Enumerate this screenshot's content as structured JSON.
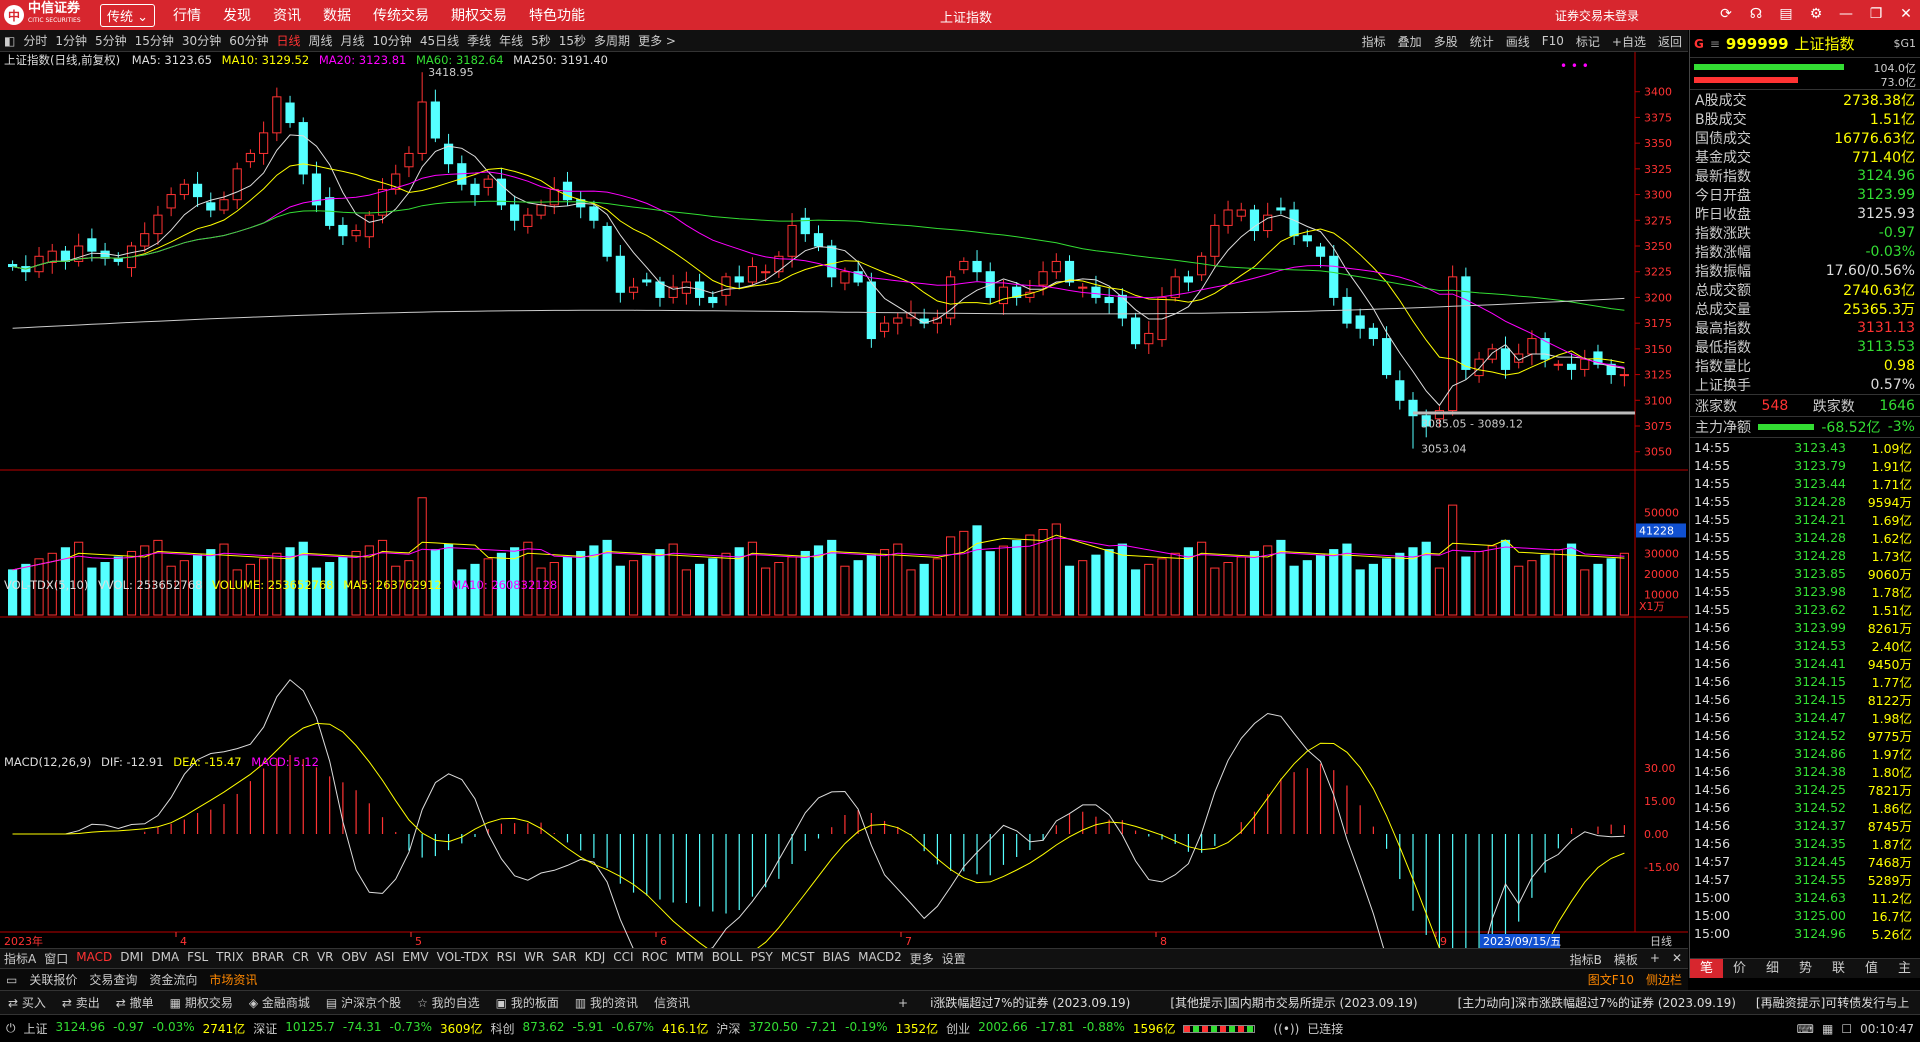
{
  "topbar": {
    "logo": "中信证券",
    "logo_en": "CITIC SECURITIES",
    "mode": "传统 ⌄",
    "menus": [
      "行情",
      "发现",
      "资讯",
      "数据",
      "传统交易",
      "期权交易",
      "特色功能"
    ],
    "title": "上证指数",
    "login": "证券交易未登录"
  },
  "periods": [
    "分时",
    "1分钟",
    "5分钟",
    "15分钟",
    "30分钟",
    "60分钟",
    "日线",
    "周线",
    "月线",
    "10分钟",
    "45日线",
    "季线",
    "年线",
    "5秒",
    "15秒",
    "多周期",
    "更多 >"
  ],
  "active_period": "日线",
  "tools": [
    "指标",
    "叠加",
    "多股",
    "统计",
    "画线",
    "F10",
    "标记",
    "+自选",
    "返回"
  ],
  "main_legend": {
    "name": "上证指数(日线,前复权)",
    "ma5": "MA5: 3123.65",
    "ma10": "MA10: 3129.52",
    "ma20": "MA20: 3123.81",
    "ma60": "MA60: 3182.64",
    "ma250": "MA250: 3191.40"
  },
  "vol_legend": {
    "name": "VOL-TDX(5,10)",
    "vvol": "VVOL: 253652768",
    "volume": "VOLUME: 253652768",
    "ma5": "MA5: 263762912",
    "ma10": "MA10: 260832128"
  },
  "macd_legend": {
    "name": "MACD(12,26,9)",
    "dif": "DIF: -12.91",
    "dea": "DEA: -15.47",
    "macd": "MACD: 5.12"
  },
  "annotations": {
    "high": "3418.95",
    "low": "3053.04",
    "range": "3085.05 - 3089.12",
    "vol_marker": "41228",
    "vol_unit": "X1万",
    "date_marker": "2023/09/15/五",
    "daily": "日线"
  },
  "price_axis": [
    "3400",
    "3375",
    "3350",
    "3325",
    "3300",
    "3275",
    "3250",
    "3225",
    "3200",
    "3175",
    "3150",
    "3125",
    "3100",
    "3075",
    "3050"
  ],
  "vol_axis": [
    "50000",
    "40000",
    "30000",
    "20000",
    "10000"
  ],
  "macd_axis": [
    "30.00",
    "15.00",
    "0.00",
    "-15.00"
  ],
  "x_axis": [
    "2023年",
    "4",
    "5",
    "6",
    "7",
    "8",
    "9"
  ],
  "chart_data": {
    "type": "candlestick",
    "title": "上证指数(日线,前复权)",
    "ylim": [
      3040,
      3425
    ],
    "latest": {
      "open": 3123.99,
      "close": 3124.96,
      "high": 3131.13,
      "low": 3113.53
    },
    "close": [
      3230,
      3225,
      3240,
      3245,
      3235,
      3250,
      3245,
      3238,
      3235,
      3250,
      3262,
      3280,
      3300,
      3310,
      3298,
      3285,
      3295,
      3325,
      3340,
      3360,
      3395,
      3370,
      3320,
      3290,
      3270,
      3260,
      3265,
      3280,
      3305,
      3320,
      3340,
      3390,
      3355,
      3330,
      3310,
      3300,
      3315,
      3290,
      3275,
      3280,
      3290,
      3305,
      3295,
      3288,
      3275,
      3240,
      3205,
      3210,
      3215,
      3200,
      3210,
      3215,
      3200,
      3195,
      3220,
      3215,
      3230,
      3225,
      3240,
      3270,
      3262,
      3250,
      3220,
      3225,
      3215,
      3160,
      3175,
      3180,
      3185,
      3175,
      3180,
      3220,
      3235,
      3225,
      3200,
      3210,
      3200,
      3205,
      3225,
      3235,
      3215,
      3210,
      3200,
      3195,
      3180,
      3155,
      3165,
      3200,
      3220,
      3215,
      3240,
      3270,
      3285,
      3285,
      3265,
      3280,
      3285,
      3260,
      3255,
      3240,
      3200,
      3175,
      3170,
      3160,
      3125,
      3100,
      3085,
      3075,
      3090,
      3220,
      3130,
      3140,
      3150,
      3130,
      3145,
      3160,
      3140,
      3135,
      3130,
      3140,
      3135,
      3125,
      3124.96
    ]
  },
  "right": {
    "code": "999999",
    "name": "上证指数",
    "sg": "$G1",
    "bar1": "104.0亿",
    "bar2": "73.0亿",
    "stats": [
      [
        "A股成交",
        "2738.38亿",
        "ye"
      ],
      [
        "B股成交",
        "1.51亿",
        "ye"
      ],
      [
        "国债成交",
        "16776.63亿",
        "ye"
      ],
      [
        "基金成交",
        "771.40亿",
        "ye"
      ],
      [
        "最新指数",
        "3124.96",
        "dn"
      ],
      [
        "今日开盘",
        "3123.99",
        "dn"
      ],
      [
        "昨日收盘",
        "3125.93",
        "wh"
      ],
      [
        "指数涨跌",
        "-0.97",
        "dn"
      ],
      [
        "指数涨幅",
        "-0.03%",
        "dn"
      ],
      [
        "指数振幅",
        "17.60/0.56%",
        "wh"
      ],
      [
        "总成交额",
        "2740.63亿",
        "ye"
      ],
      [
        "总成交量",
        "25365.3万",
        "ye"
      ],
      [
        "最高指数",
        "3131.13",
        "up"
      ],
      [
        "最低指数",
        "3113.53",
        "dn"
      ],
      [
        "指数量比",
        "0.98",
        "ye"
      ],
      [
        "上证换手",
        "0.57%",
        "wh"
      ]
    ],
    "updown": {
      "up_label": "涨家数",
      "up": "548",
      "down_label": "跌家数",
      "down": "1646"
    },
    "flow": {
      "label": "主力净额",
      "value": "-68.52亿",
      "pct": "-3%"
    },
    "ticks": [
      [
        "14:55",
        "3123.43",
        "1.09亿"
      ],
      [
        "14:55",
        "3123.79",
        "1.91亿"
      ],
      [
        "14:55",
        "3123.44",
        "1.71亿"
      ],
      [
        "14:55",
        "3124.28",
        "9594万"
      ],
      [
        "14:55",
        "3124.21",
        "1.69亿"
      ],
      [
        "14:55",
        "3124.28",
        "1.62亿"
      ],
      [
        "14:55",
        "3124.28",
        "1.73亿"
      ],
      [
        "14:55",
        "3123.85",
        "9060万"
      ],
      [
        "14:55",
        "3123.98",
        "1.78亿"
      ],
      [
        "14:55",
        "3123.62",
        "1.51亿"
      ],
      [
        "14:56",
        "3123.99",
        "8261万"
      ],
      [
        "14:56",
        "3124.53",
        "2.40亿"
      ],
      [
        "14:56",
        "3124.41",
        "9450万"
      ],
      [
        "14:56",
        "3124.15",
        "1.77亿"
      ],
      [
        "14:56",
        "3124.15",
        "8122万"
      ],
      [
        "14:56",
        "3124.47",
        "1.98亿"
      ],
      [
        "14:56",
        "3124.52",
        "9775万"
      ],
      [
        "14:56",
        "3124.86",
        "1.97亿"
      ],
      [
        "14:56",
        "3124.38",
        "1.80亿"
      ],
      [
        "14:56",
        "3124.25",
        "7821万"
      ],
      [
        "14:56",
        "3124.52",
        "1.86亿"
      ],
      [
        "14:56",
        "3124.37",
        "8745万"
      ],
      [
        "14:56",
        "3124.35",
        "1.87亿"
      ],
      [
        "14:57",
        "3124.45",
        "7468万"
      ],
      [
        "14:57",
        "3124.55",
        "5289万"
      ],
      [
        "15:00",
        "3124.63",
        "11.2亿"
      ],
      [
        "15:00",
        "3125.00",
        "16.7亿"
      ],
      [
        "15:00",
        "3124.96",
        "5.26亿"
      ]
    ],
    "tabs": [
      "笔",
      "价",
      "细",
      "势",
      "联",
      "值",
      "主"
    ]
  },
  "indicators": [
    "指标A",
    "窗口",
    "MACD",
    "DMI",
    "DMA",
    "FSL",
    "TRIX",
    "BRAR",
    "CR",
    "VR",
    "OBV",
    "ASI",
    "EMV",
    "VOL-TDX",
    "RSI",
    "WR",
    "SAR",
    "KDJ",
    "CCI",
    "ROC",
    "MTM",
    "BOLL",
    "PSY",
    "MCST",
    "BIAS",
    "MACD2",
    "更多",
    "设置"
  ],
  "ind_right": [
    "指标B",
    "模板",
    "+",
    "✕"
  ],
  "newsbar": [
    "关联报价",
    "交易查询",
    "资金流向",
    "市场资讯"
  ],
  "news_right": [
    "图文F10",
    "侧边栏"
  ],
  "actions": [
    "买入",
    "卖出",
    "撤单",
    "期权交易",
    "金融商城",
    "沪深京个股",
    "我的自选",
    "我的板面",
    "我的资讯",
    "信资讯"
  ],
  "news": [
    "i涨跌幅超过7%的证券 (2023.09.19)",
    "[其他提示]国内期市交易所提示 (2023.09.19)",
    "[主力动向]深市涨跌幅超过7%的证券 (2023.09.19)",
    "[再融资提示]可转债发行与上"
  ],
  "status": [
    [
      "上证",
      "3124.96",
      "-0.97",
      "-0.03%",
      "2741亿"
    ],
    [
      "深证",
      "10125.7",
      "-74.31",
      "-0.73%",
      "3609亿"
    ],
    [
      "科创",
      "873.62",
      "-5.91",
      "-0.67%",
      "416.1亿"
    ],
    [
      "沪深",
      "3720.50",
      "-7.21",
      "-0.19%",
      "1352亿"
    ],
    [
      "创业",
      "2002.66",
      "-17.81",
      "-0.88%",
      "1596亿"
    ]
  ],
  "connect": "已连接",
  "clock": "00:10:47"
}
